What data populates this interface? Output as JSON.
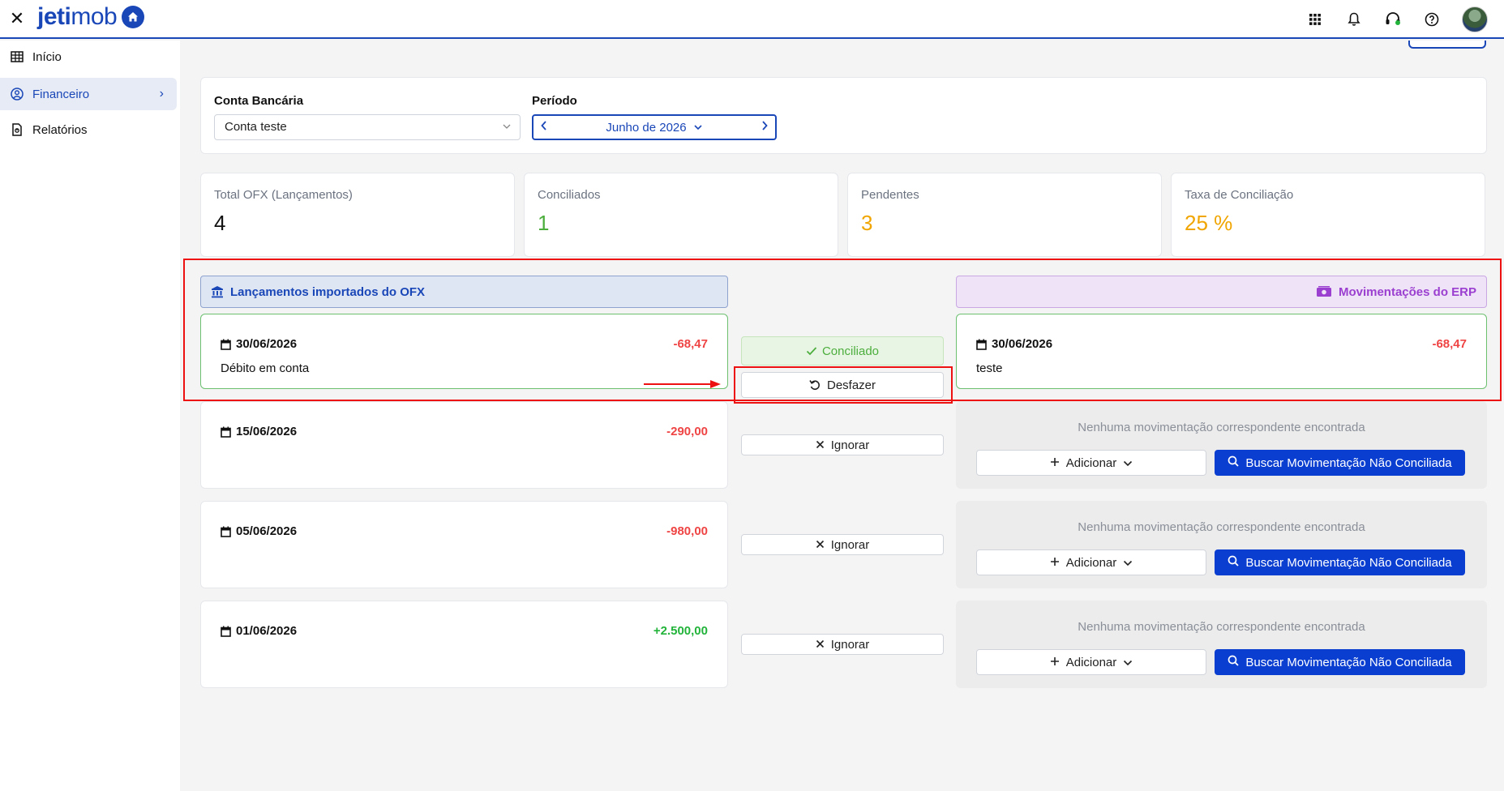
{
  "header": {
    "logo_text_bold": "jeti",
    "logo_text_light": "mob",
    "icons": [
      "close-icon",
      "apps-grid-icon",
      "bell-icon",
      "support-icon",
      "help-icon",
      "avatar"
    ]
  },
  "sidebar": {
    "items": [
      {
        "label": "Início",
        "icon": "grid-icon",
        "active": false
      },
      {
        "label": "Financeiro",
        "icon": "finance-icon",
        "active": true
      },
      {
        "label": "Relatórios",
        "icon": "report-icon",
        "active": false
      }
    ]
  },
  "filters": {
    "account_label": "Conta Bancária",
    "account_value": "Conta teste",
    "period_label": "Período",
    "period_value": "Junho de 2026"
  },
  "stats": [
    {
      "label": "Total OFX (Lançamentos)",
      "value": "4",
      "color": "#111111"
    },
    {
      "label": "Conciliados",
      "value": "1",
      "color": "#4cae3d"
    },
    {
      "label": "Pendentes",
      "value": "3",
      "color": "#f0a500"
    },
    {
      "label": "Taxa de Conciliação",
      "value": "25 %",
      "color": "#f0a500"
    }
  ],
  "columns": {
    "ofx_title": "Lançamentos importados do OFX",
    "erp_title": "Movimentações do ERP"
  },
  "reconciled": {
    "ofx": {
      "date": "30/06/2026",
      "amount": "-68,47",
      "description": "Débito em conta"
    },
    "status": "Conciliado",
    "undo_label": "Desfazer",
    "erp": {
      "date": "30/06/2026",
      "amount": "-68,47",
      "description": "teste"
    }
  },
  "pending": [
    {
      "date": "15/06/2026",
      "amount": "-290,00",
      "sign": "neg"
    },
    {
      "date": "05/06/2026",
      "amount": "-980,00",
      "sign": "neg"
    },
    {
      "date": "01/06/2026",
      "amount": "+2.500,00",
      "sign": "pos"
    }
  ],
  "pending_actions": {
    "ignore_label": "Ignorar",
    "empty_message": "Nenhuma movimentação correspondente encontrada",
    "add_label": "Adicionar",
    "search_label": "Buscar Movimentação Não Conciliada"
  }
}
